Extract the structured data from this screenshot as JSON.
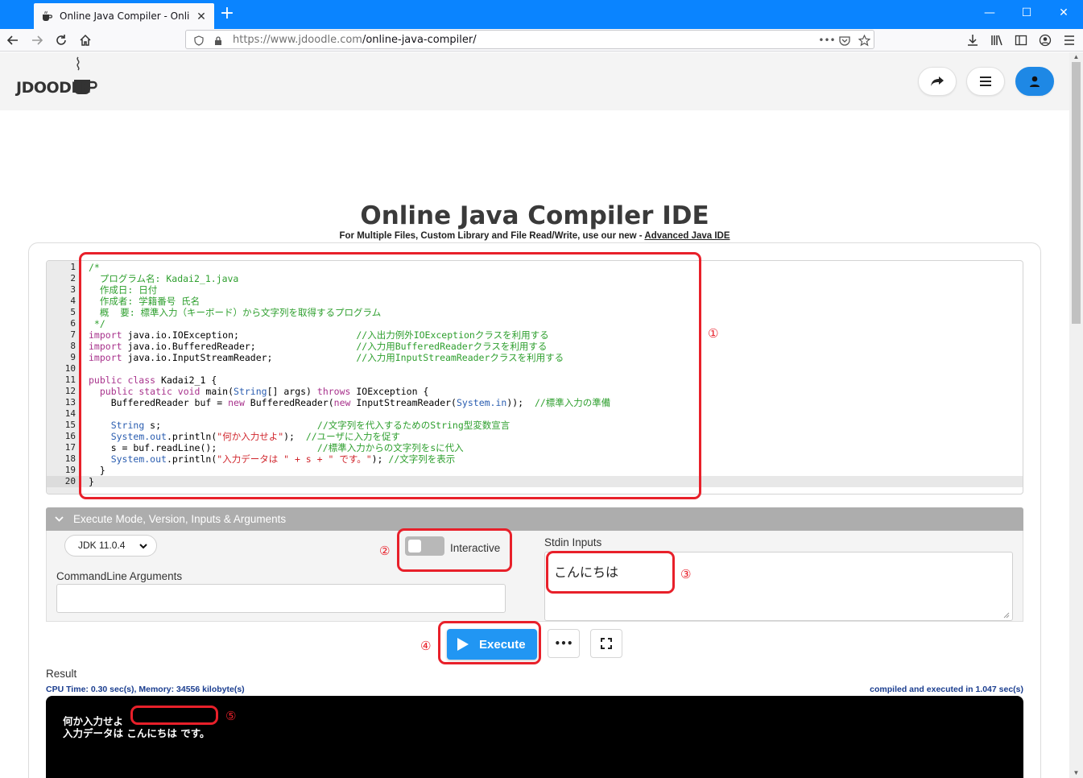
{
  "browser": {
    "tab_title": "Online Java Compiler - Online",
    "tab_close": "✕",
    "new_tab": "+",
    "win_minimize": "—",
    "win_maximize": "☐",
    "win_close": "✕",
    "url_host": "https://www.jdoodle.com",
    "url_path": "/online-java-compiler/",
    "url_more": "•••"
  },
  "page": {
    "title": "Online Java Compiler IDE",
    "subtitle_text": "For Multiple Files, Custom Library and File Read/Write, use our new - ",
    "subtitle_link": "Advanced Java IDE"
  },
  "editor": {
    "line_numbers": [
      "1",
      "2",
      "3",
      "4",
      "5",
      "6",
      "7",
      "8",
      "9",
      "10",
      "11",
      "12",
      "13",
      "14",
      "15",
      "16",
      "17",
      "18",
      "19",
      "20"
    ]
  },
  "options": {
    "header": "Execute Mode, Version, Inputs & Arguments",
    "jdk_version": "JDK 11.0.4",
    "interactive_label": "Interactive",
    "interactive_on": false,
    "cmdline_label": "CommandLine Arguments",
    "cmdline_value": "",
    "stdin_label": "Stdin Inputs",
    "stdin_value": "こんにちは"
  },
  "actions": {
    "execute_label": "Execute",
    "more_label": "•••"
  },
  "result": {
    "label": "Result",
    "cpu_info": "CPU Time: 0.30 sec(s), Memory: 34556 kilobyte(s)",
    "compiled_info": "compiled and executed in 1.047 sec(s)",
    "output_line1": "何か入力せよ",
    "output_line2": "入力データは こんにちは です。"
  },
  "annotations": {
    "n1": "①",
    "n2": "②",
    "n3": "③",
    "n4": "④",
    "n5": "⑤"
  },
  "colors": {
    "accent": "#2196f3",
    "annotation_red": "#e8202a",
    "firefox_tabbar": "#0a84ff",
    "panel_header": "#adadad"
  }
}
